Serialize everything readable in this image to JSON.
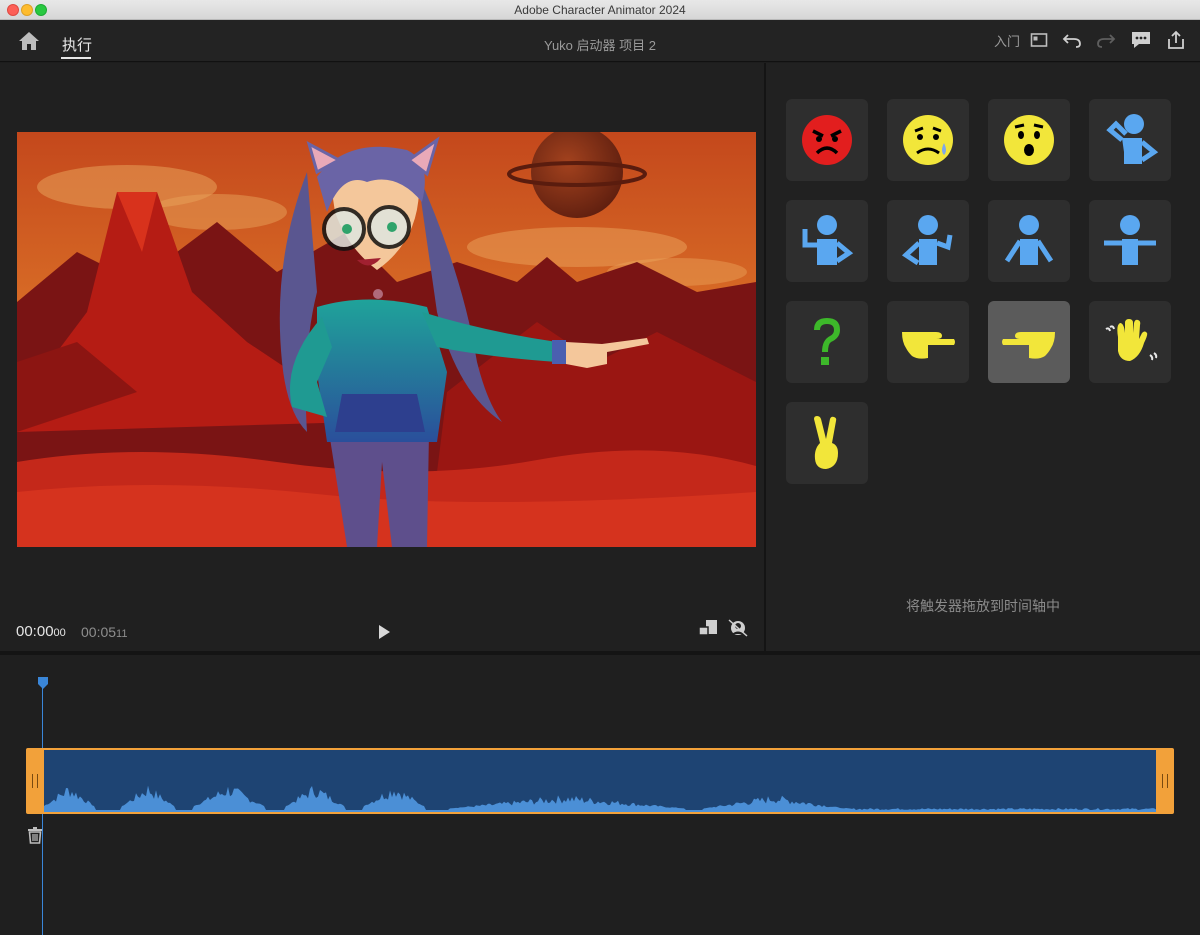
{
  "window": {
    "title": "Adobe Character Animator 2024"
  },
  "header": {
    "tab_perform": "执行",
    "project_title": "Yuko 启动器 项目 2",
    "getting_started": "入门"
  },
  "stage": {
    "current_time": "00:00",
    "current_frames": "00",
    "duration_time": "00:05",
    "duration_frames": "11"
  },
  "triggers": {
    "items": [
      {
        "id": "angry",
        "icon": "angry-face-icon"
      },
      {
        "id": "sad",
        "icon": "sad-face-icon"
      },
      {
        "id": "surprised",
        "icon": "surprised-face-icon"
      },
      {
        "id": "thinking",
        "icon": "thinking-pose-icon"
      },
      {
        "id": "hand-on-hip",
        "icon": "hand-on-hip-pose-icon"
      },
      {
        "id": "shrug",
        "icon": "shrug-pose-icon"
      },
      {
        "id": "arms-down",
        "icon": "arms-down-pose-icon"
      },
      {
        "id": "t-pose",
        "icon": "t-pose-icon"
      },
      {
        "id": "question",
        "icon": "question-mark-icon"
      },
      {
        "id": "point-right",
        "icon": "point-right-hand-icon"
      },
      {
        "id": "point-left",
        "icon": "point-left-hand-icon",
        "selected": true
      },
      {
        "id": "wave",
        "icon": "waving-hand-icon"
      },
      {
        "id": "peace",
        "icon": "peace-sign-hand-icon"
      }
    ],
    "hint": "将触发器拖放到时间轴中"
  },
  "colors": {
    "accent_blue": "#3a86d8",
    "clip_orange": "#f2a13a",
    "clip_fill": "#1e4473",
    "emoji_yellow": "#f2e63a",
    "pose_blue": "#5aa7f0"
  }
}
